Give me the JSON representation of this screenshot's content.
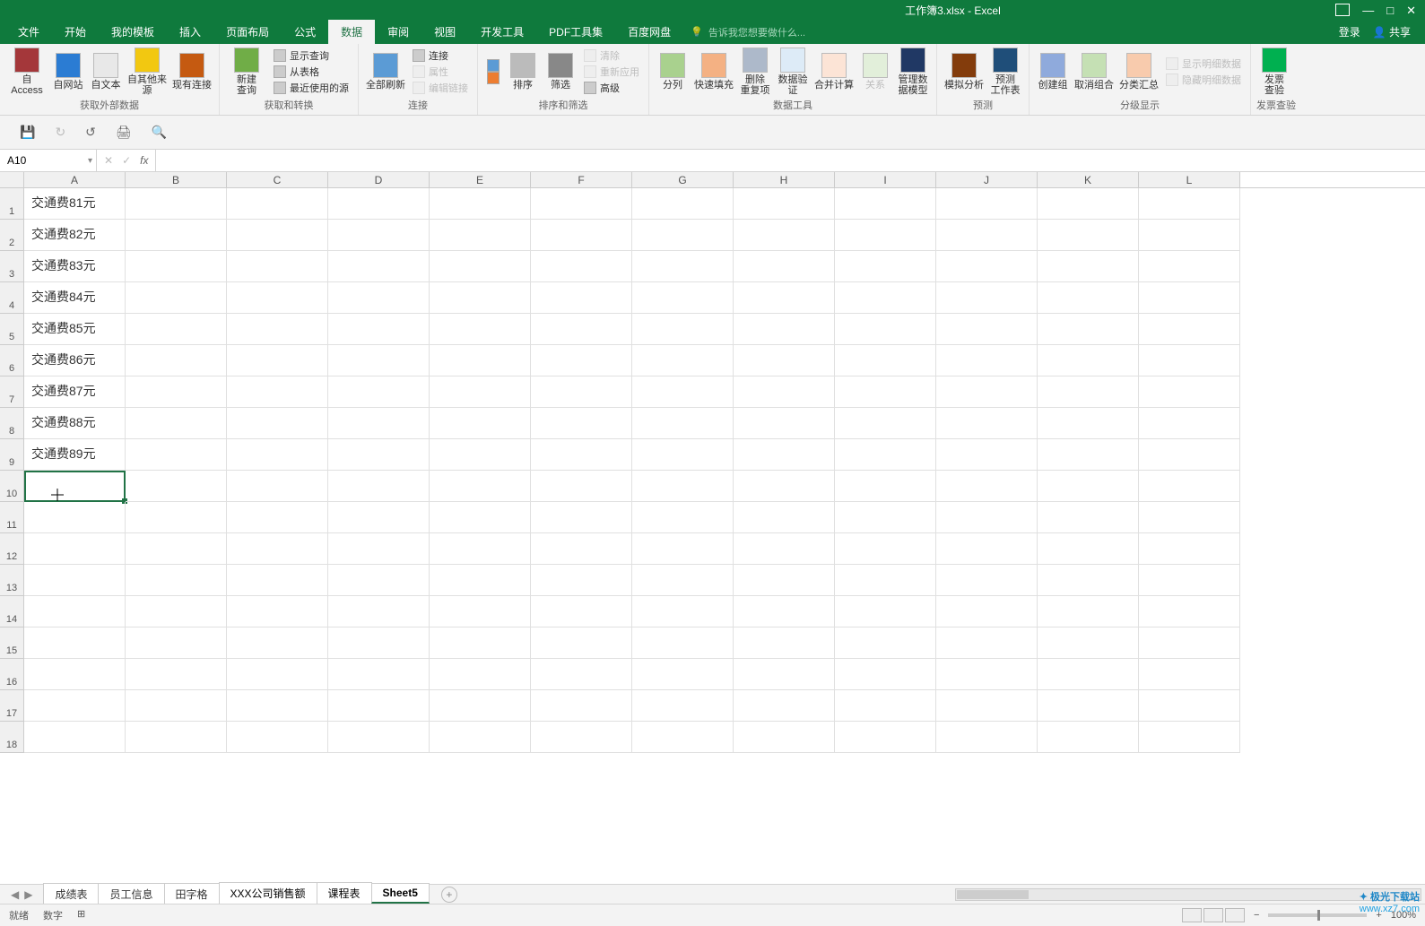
{
  "title": "工作簿3.xlsx - Excel",
  "window_controls": {
    "restore": "▭",
    "min": "—",
    "max": "□",
    "close": "✕"
  },
  "menu_right": {
    "login": "登录",
    "share": "共享"
  },
  "tabs": [
    "文件",
    "开始",
    "我的模板",
    "插入",
    "页面布局",
    "公式",
    "数据",
    "审阅",
    "视图",
    "开发工具",
    "PDF工具集",
    "百度网盘"
  ],
  "active_tab_index": 6,
  "tell_me": "告诉我您想要做什么...",
  "ribbon": {
    "g1": {
      "label": "获取外部数据",
      "btns": [
        "自 Access",
        "自网站",
        "自文本",
        "自其他来源",
        "现有连接"
      ]
    },
    "g2": {
      "label": "获取和转换",
      "query": "新建\n查询",
      "lines": [
        "显示查询",
        "从表格",
        "最近使用的源"
      ]
    },
    "g3": {
      "label": "连接",
      "refresh": "全部刷新",
      "lines": [
        "连接",
        "属性",
        "编辑链接"
      ]
    },
    "g4": {
      "label": "排序和筛选",
      "sort": "排序",
      "filter": "筛选",
      "lines": [
        "清除",
        "重新应用",
        "高级"
      ]
    },
    "g5": {
      "label": "数据工具",
      "btns": [
        "分列",
        "快速填充",
        "删除\n重复项",
        "数据验\n证",
        "合并计算",
        "关系",
        "管理数\n据模型"
      ]
    },
    "g6": {
      "label": "预测",
      "btns": [
        "模拟分析",
        "预测\n工作表"
      ]
    },
    "g7": {
      "label": "分级显示",
      "btns": [
        "创建组",
        "取消组合",
        "分类汇总"
      ],
      "lines": [
        "显示明细数据",
        "隐藏明细数据"
      ]
    },
    "g8": {
      "label": "发票查验",
      "btn": "发票\n查验"
    }
  },
  "name_box": "A10",
  "columns": [
    "A",
    "B",
    "C",
    "D",
    "E",
    "F",
    "G",
    "H",
    "I",
    "J",
    "K",
    "L"
  ],
  "rows": [
    {
      "n": 1,
      "a": "交通费81元"
    },
    {
      "n": 2,
      "a": "交通费82元"
    },
    {
      "n": 3,
      "a": "交通费83元"
    },
    {
      "n": 4,
      "a": "交通费84元"
    },
    {
      "n": 5,
      "a": "交通费85元"
    },
    {
      "n": 6,
      "a": "交通费86元"
    },
    {
      "n": 7,
      "a": "交通费87元"
    },
    {
      "n": 8,
      "a": "交通费88元"
    },
    {
      "n": 9,
      "a": "交通费89元"
    },
    {
      "n": 10,
      "a": ""
    },
    {
      "n": 11,
      "a": ""
    },
    {
      "n": 12,
      "a": ""
    },
    {
      "n": 13,
      "a": ""
    },
    {
      "n": 14,
      "a": ""
    },
    {
      "n": 15,
      "a": ""
    },
    {
      "n": 16,
      "a": ""
    },
    {
      "n": 17,
      "a": ""
    },
    {
      "n": 18,
      "a": ""
    }
  ],
  "selected_row": 10,
  "sheets": [
    "成绩表",
    "员工信息",
    "田字格",
    "XXX公司销售额",
    "课程表",
    "Sheet5"
  ],
  "status": {
    "ready": "就绪",
    "mode": "数字",
    "zoom": "100%"
  },
  "watermark": {
    "name": "极光下载站",
    "url": "www.xz7.com"
  }
}
